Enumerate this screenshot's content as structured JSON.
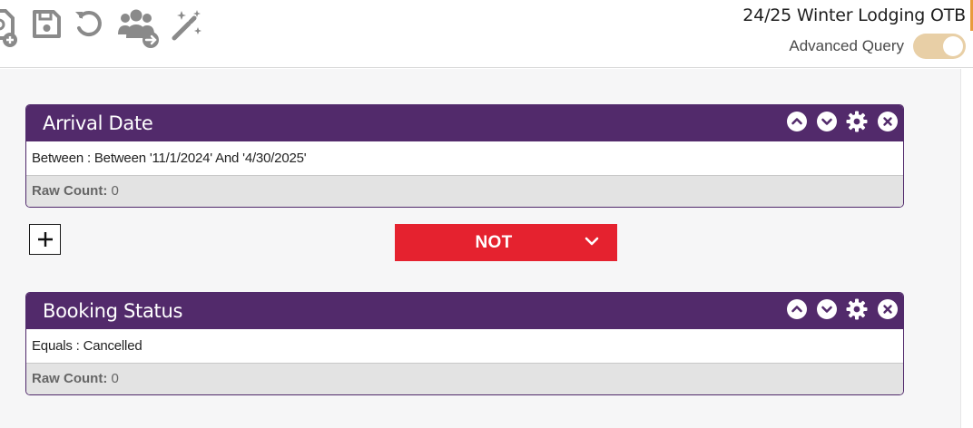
{
  "header": {
    "query_title": "24/25 Winter Lodging OTB",
    "advanced_query_label": "Advanced Query",
    "advanced_query_enabled": true,
    "toolbar_icons": [
      "new-query-icon",
      "save-icon",
      "undo-icon",
      "share-users-icon",
      "magic-wand-icon"
    ]
  },
  "filters": [
    {
      "title": "Arrival Date",
      "condition": "Between : Between '11/1/2024' And '4/30/2025'",
      "raw_count_label": "Raw Count:",
      "raw_count_value": "0"
    },
    {
      "title": "Booking Status",
      "condition": "Equals : Cancelled",
      "raw_count_label": "Raw Count:",
      "raw_count_value": "0"
    }
  ],
  "operator": {
    "label": "NOT",
    "add_symbol": "+"
  },
  "colors": {
    "card_header": "#522a6b",
    "operator_button": "#e5222f",
    "toggle": "#e8cfa6"
  }
}
